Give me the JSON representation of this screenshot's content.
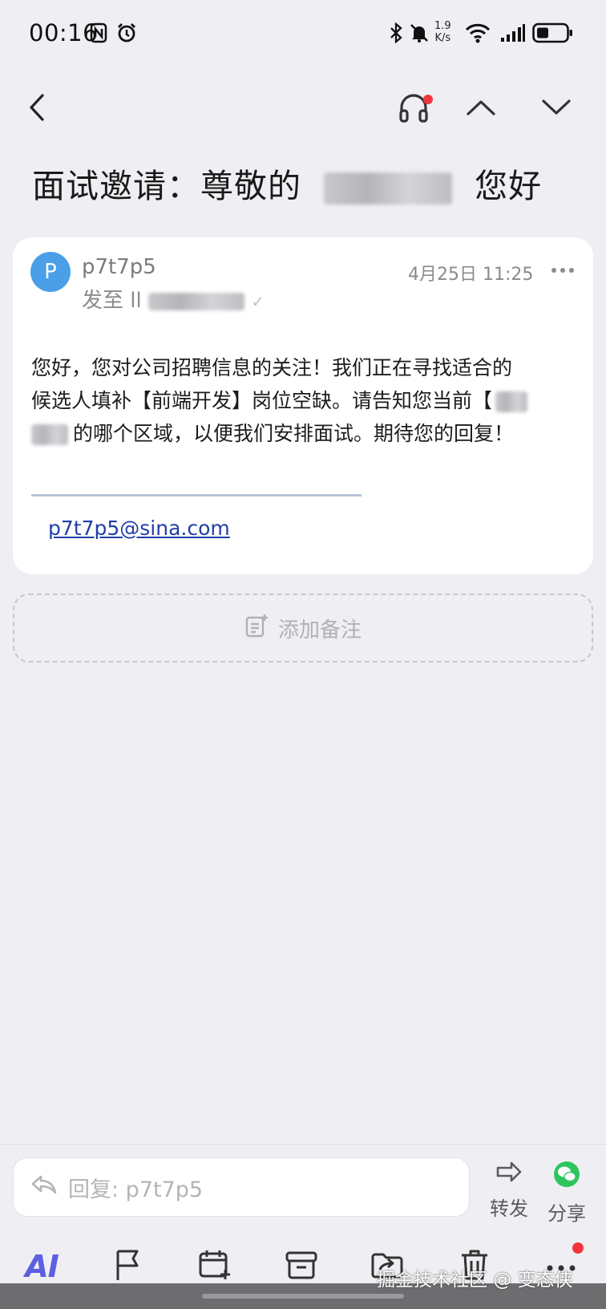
{
  "status_bar": {
    "time": "00:16",
    "net_speed_value": "1.9",
    "net_speed_unit": "K/s",
    "icons": [
      "nfc-icon",
      "alarm-icon",
      "bluetooth-icon",
      "mute-icon",
      "wifi-icon",
      "signal-icon",
      "battery-icon"
    ]
  },
  "nav": {
    "icons": [
      "back-icon",
      "headphones-icon",
      "prev-mail-icon",
      "next-mail-icon"
    ],
    "headphones_badge": true
  },
  "mail": {
    "subject_prefix": "面试邀请：尊敬的",
    "subject_suffix": "您好",
    "avatar_letter": "P",
    "sender": "p7t7p5",
    "recipient_prefix": "发至 ll",
    "date": "4月25日 11:25",
    "body_line1": "您好，您对公司招聘信息的关注！我们正在寻找适合的",
    "body_line2": "候选人填补【前端开发】岗位空缺。请告知您当前【",
    "body_line3": "的哪个区域，以便我们安排面试。期待您的回复！",
    "signature_email": "p7t7p5@sina.com"
  },
  "add_note_label": "添加备注",
  "reply": {
    "placeholder": "回复: p7t7p5",
    "forward_label": "转发",
    "share_label": "分享"
  },
  "toolbar": {
    "ai_label": "AI",
    "icons": [
      "flag-icon",
      "calendar-add-icon",
      "archive-icon",
      "move-folder-icon",
      "delete-icon",
      "more-icon"
    ]
  },
  "watermark": "掘金技术社区 @ 变态侠",
  "colors": {
    "accent_blue": "#4a9fe8",
    "link_blue": "#1f3fa8",
    "ai_purple": "#5b5fe0",
    "share_green": "#2dc55e",
    "badge_red": "#f2353a"
  }
}
